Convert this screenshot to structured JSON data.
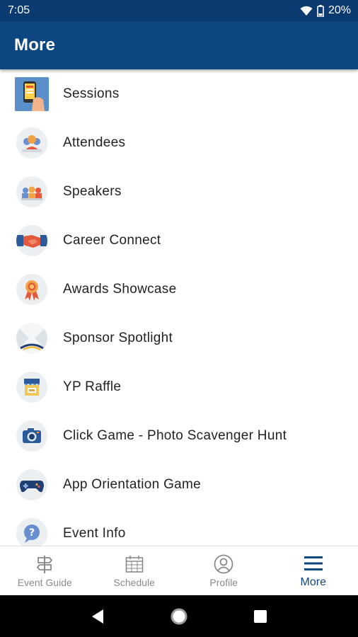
{
  "status_bar": {
    "time": "7:05",
    "battery": "20%",
    "icons": [
      "wifi-icon",
      "battery-icon"
    ]
  },
  "app_bar": {
    "title": "More",
    "background": "#0d4681"
  },
  "menu": {
    "items": [
      {
        "label": "Sessions",
        "icon": "sessions-phone-icon"
      },
      {
        "label": "Attendees",
        "icon": "attendees-icon"
      },
      {
        "label": "Speakers",
        "icon": "speakers-icon"
      },
      {
        "label": "Career Connect",
        "icon": "handshake-icon"
      },
      {
        "label": "Awards Showcase",
        "icon": "award-ribbon-icon"
      },
      {
        "label": "Sponsor Spotlight",
        "icon": "spotlight-icon"
      },
      {
        "label": "YP Raffle",
        "icon": "raffle-booth-icon"
      },
      {
        "label": "Click Game - Photo Scavenger Hunt",
        "icon": "camera-icon"
      },
      {
        "label": "App Orientation Game",
        "icon": "gamepad-icon"
      },
      {
        "label": "Event Info",
        "icon": "question-bubble-icon"
      }
    ]
  },
  "bottom_nav": {
    "tabs": [
      {
        "label": "Event Guide",
        "icon": "signpost-icon"
      },
      {
        "label": "Schedule",
        "icon": "calendar-icon"
      },
      {
        "label": "Profile",
        "icon": "profile-icon"
      },
      {
        "label": "More",
        "icon": "hamburger-menu-icon"
      }
    ],
    "active": "More",
    "active_color": "#0d4681",
    "inactive_color": "#8a8a8a"
  },
  "android_nav": {
    "buttons": [
      "back-icon",
      "home-icon",
      "recents-icon"
    ]
  }
}
